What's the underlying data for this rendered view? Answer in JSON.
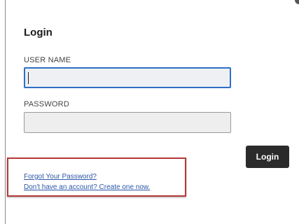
{
  "dialog": {
    "title": "Login"
  },
  "fields": {
    "username": {
      "label": "USER NAME",
      "value": "",
      "placeholder": ""
    },
    "password": {
      "label": "PASSWORD",
      "value": "",
      "placeholder": ""
    }
  },
  "actions": {
    "login_label": "Login"
  },
  "links": {
    "forgot_password": "Forgot Your Password?",
    "create_account": "Don't have an account? Create one now."
  },
  "colors": {
    "focus_border": "#2e70c9",
    "button_bg": "#2b2b2b",
    "link": "#2b56a8",
    "highlight_box": "#b53a3a"
  }
}
